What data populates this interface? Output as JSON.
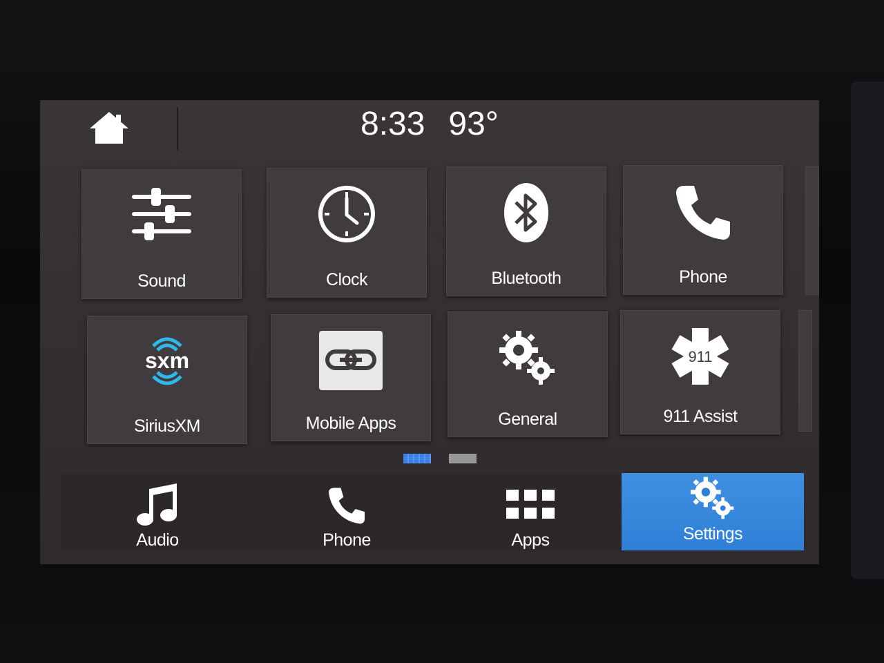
{
  "status": {
    "time": "8:33",
    "temperature": "93°"
  },
  "tiles": [
    {
      "label": "Sound",
      "icon": "sliders-icon"
    },
    {
      "label": "Clock",
      "icon": "clock-icon"
    },
    {
      "label": "Bluetooth",
      "icon": "bluetooth-icon"
    },
    {
      "label": "Phone",
      "icon": "phone-icon"
    },
    {
      "label": "SiriusXM",
      "icon": "siriusxm-logo",
      "logo_text": "sxm"
    },
    {
      "label": "Mobile Apps",
      "icon": "link-icon"
    },
    {
      "label": "General",
      "icon": "gears-icon"
    },
    {
      "label": "911 Assist",
      "icon": "star-of-life-icon",
      "badge_text": "911"
    }
  ],
  "pagination": {
    "current": 1,
    "total": 2,
    "active_color": "#3b82e6",
    "inactive_color": "#9a979a"
  },
  "bottom_nav": [
    {
      "label": "Audio",
      "icon": "music-note-icon"
    },
    {
      "label": "Phone",
      "icon": "phone-icon"
    },
    {
      "label": "Apps",
      "icon": "grid-icon"
    },
    {
      "label": "Settings",
      "icon": "gears-icon",
      "active": true
    }
  ],
  "colors": {
    "accent": "#2f7fd8",
    "sxm_blue": "#2fb9e8"
  }
}
